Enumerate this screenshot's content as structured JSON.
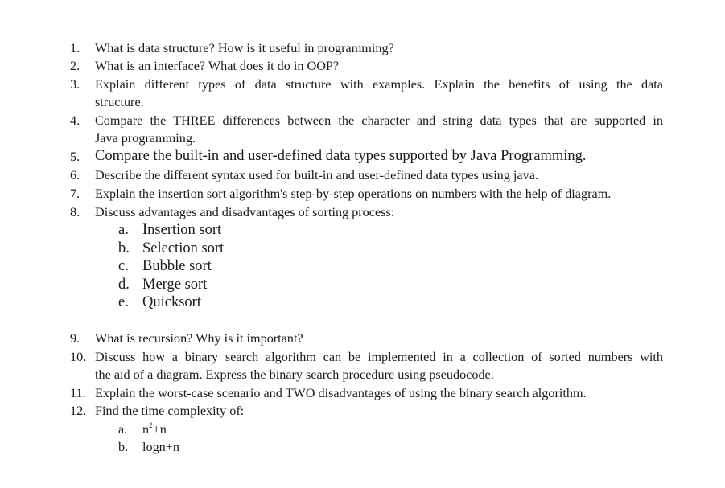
{
  "questions": [
    {
      "num": "1.",
      "lines": [
        "What is data structure? How is it useful in programming?"
      ]
    },
    {
      "num": "2.",
      "lines": [
        "What is an interface? What does it do in OOP?"
      ]
    },
    {
      "num": "3.",
      "lines": [
        "Explain different types of data structure with examples. Explain the benefits of using the data",
        "structure."
      ]
    },
    {
      "num": "4.",
      "lines": [
        "Compare the THREE differences between the character and string data types that are supported in",
        "Java programming."
      ]
    },
    {
      "num": "5.",
      "lines": [
        "Compare the built-in and user-defined data types supported by Java Programming."
      ]
    },
    {
      "num": "6.",
      "lines": [
        "Describe the different syntax used for built-in and user-defined data types using java."
      ]
    },
    {
      "num": "7.",
      "lines": [
        "Explain the insertion sort algorithm's step-by-step operations on numbers with the help of diagram."
      ]
    },
    {
      "num": "8.",
      "lines": [
        "Discuss advantages and disadvantages of sorting process:"
      ],
      "sub": [
        {
          "num": "a.",
          "text": "Insertion sort"
        },
        {
          "num": "b.",
          "text": "Selection sort"
        },
        {
          "num": "c.",
          "text": "Bubble sort"
        },
        {
          "num": "d.",
          "text": "Merge sort"
        },
        {
          "num": "e.",
          "text": "Quicksort"
        }
      ]
    },
    {
      "num": "9.",
      "lines": [
        "What is recursion? Why is it important?"
      ]
    },
    {
      "num": "10.",
      "lines": [
        "Discuss how a binary search algorithm can be implemented in a collection of sorted numbers with",
        "the aid of a diagram. Express the binary search procedure using pseudocode."
      ]
    },
    {
      "num": "11.",
      "lines": [
        "Explain the worst-case scenario and TWO disadvantages of using the binary search algorithm."
      ]
    },
    {
      "num": "12.",
      "lines": [
        "Find the time complexity of:"
      ],
      "sub": [
        {
          "num": "a.",
          "base": "n",
          "exp": "2",
          "rest": "+n"
        },
        {
          "num": "b.",
          "text": "logn+n"
        }
      ]
    }
  ]
}
